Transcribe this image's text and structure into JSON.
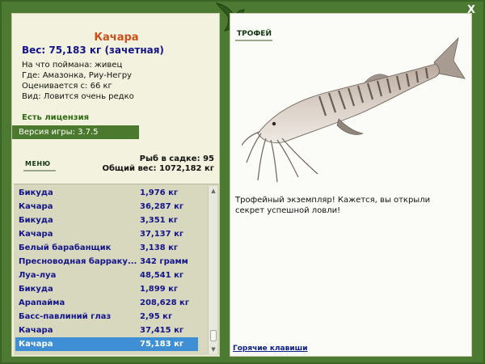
{
  "window": {
    "close_label": "X"
  },
  "catch": {
    "name": "Качара",
    "weight_line": "Вес: 75,183 кг (зачетная)",
    "bait_line": "На что поймана: живец",
    "place_line": "Где: Амазонка, Риу-Негру",
    "rated_line": "Оценивается с: 66 кг",
    "view_line": "Вид: Ловится очень редко"
  },
  "license_label": "Есть лицензия",
  "version_label": "Версия игры: 3.7.5",
  "menu_label": "МЕНЮ",
  "stats": {
    "fish_in_keepnet": "Рыб в садке: 95",
    "total_weight": "Общий вес: 1072,182 кг"
  },
  "catch_list": [
    {
      "name": "Бикуда",
      "weight": "1,976 кг"
    },
    {
      "name": "Качара",
      "weight": "36,287 кг"
    },
    {
      "name": "Бикуда",
      "weight": "3,351 кг"
    },
    {
      "name": "Качара",
      "weight": "37,137 кг"
    },
    {
      "name": "Белый барабанщик",
      "weight": "3,138 кг"
    },
    {
      "name": "Пресноводная барраку...",
      "weight": "342 грамм"
    },
    {
      "name": "Луа-луа",
      "weight": "48,541 кг"
    },
    {
      "name": "Бикуда",
      "weight": "1,899 кг"
    },
    {
      "name": "Арапайма",
      "weight": "208,628 кг"
    },
    {
      "name": "Басс-павлиний глаз",
      "weight": "2,95 кг"
    },
    {
      "name": "Качара",
      "weight": "37,415 кг"
    },
    {
      "name": "Качара",
      "weight": "75,183 кг"
    }
  ],
  "trophy": {
    "title": "ТРОФЕЙ",
    "message": "Трофейный экземпляр! Кажется, вы открыли секрет успешной ловли!"
  },
  "hotkeys_label": "Горячие клавиши",
  "colors": {
    "frame": "#4c7a33",
    "panel": "#f3f2de",
    "name_orange": "#c8501b",
    "weight_blue": "#14148a",
    "selection": "#3f8fd6"
  }
}
